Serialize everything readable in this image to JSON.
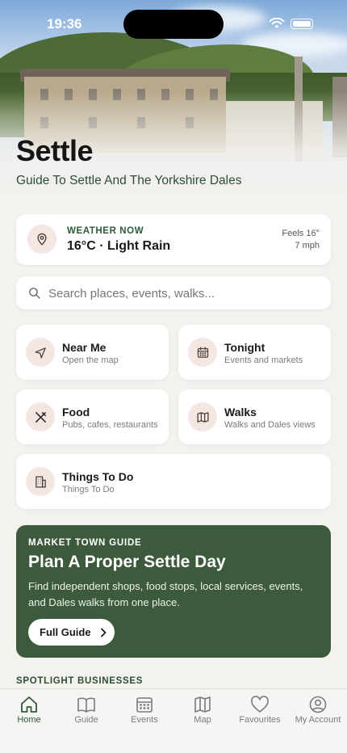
{
  "status_bar": {
    "time": "19:36"
  },
  "header": {
    "title": "Settle",
    "subtitle": "Guide To Settle And The Yorkshire Dales"
  },
  "weather": {
    "kicker": "WEATHER NOW",
    "summary": "16°C · Light Rain",
    "feels": "Feels 16°",
    "wind": "7 mph",
    "icon": "location-pin-icon"
  },
  "search": {
    "placeholder": "Search places, events, walks..."
  },
  "tiles": [
    {
      "title": "Near Me",
      "subtitle": "Open the map",
      "icon": "navigation-arrow-icon"
    },
    {
      "title": "Tonight",
      "subtitle": "Events and markets",
      "icon": "calendar-icon"
    },
    {
      "title": "Food",
      "subtitle": "Pubs, cafes, restaurants",
      "icon": "utensils-icon"
    },
    {
      "title": "Walks",
      "subtitle": "Walks and Dales views",
      "icon": "map-icon"
    },
    {
      "title": "Things To Do",
      "subtitle": "Things To Do",
      "icon": "building-icon"
    }
  ],
  "promo": {
    "kicker": "MARKET TOWN GUIDE",
    "title": "Plan A Proper Settle Day",
    "body": "Find independent shops, food stops, local services, events, and Dales walks from one place.",
    "button_label": "Full Guide"
  },
  "spotlight_label": "SPOTLIGHT BUSINESSES",
  "tabbar": [
    {
      "label": "Home",
      "icon": "home-icon",
      "active": true
    },
    {
      "label": "Guide",
      "icon": "book-icon",
      "active": false
    },
    {
      "label": "Events",
      "icon": "calendar-icon",
      "active": false
    },
    {
      "label": "Map",
      "icon": "map-icon",
      "active": false
    },
    {
      "label": "Favourites",
      "icon": "heart-icon",
      "active": false
    },
    {
      "label": "My Account",
      "icon": "account-icon",
      "active": false
    }
  ],
  "colors": {
    "accent_green": "#2d5a38",
    "promo_bg": "#3d5a3c",
    "icon_circle_bg": "#f4e6e3",
    "page_bg": "#f4f2ee"
  }
}
